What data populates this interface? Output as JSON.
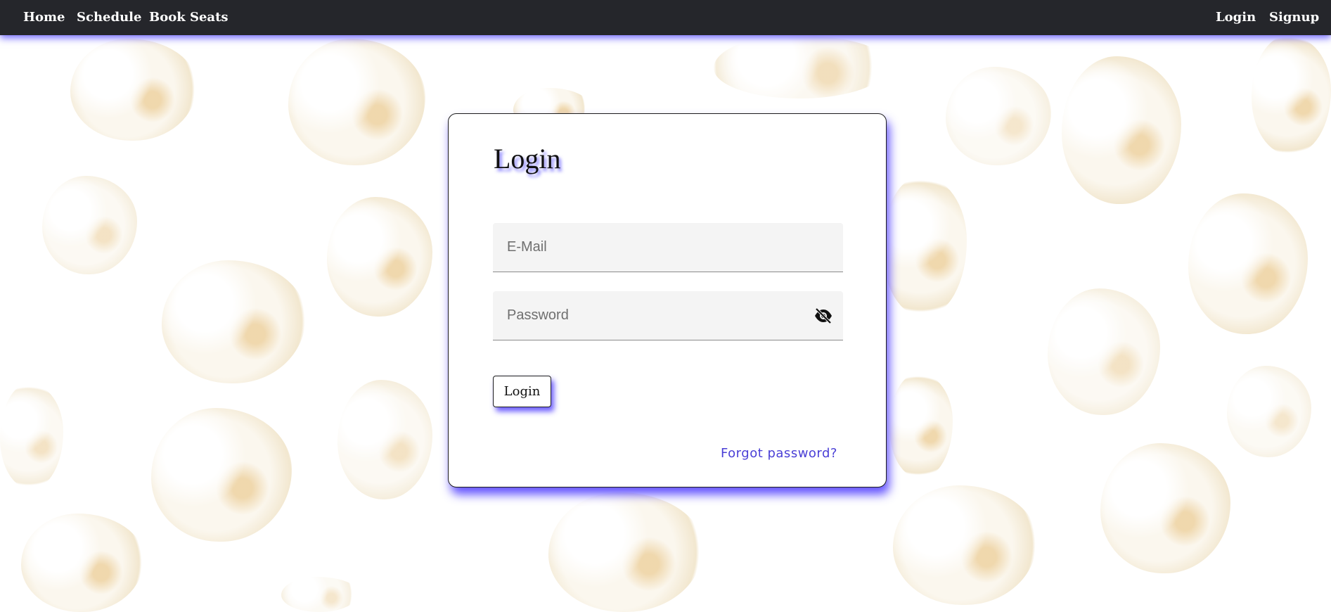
{
  "nav": {
    "home_label": "Home",
    "schedule_label": "Schedule",
    "book_seats_label": "Book Seats",
    "login_label": "Login",
    "signup_label": "Signup"
  },
  "login_form": {
    "title": "Login",
    "email_placeholder": "E-Mail",
    "email_value": "",
    "password_placeholder": "Password",
    "password_value": "",
    "password_toggle_icon": "eye-off-icon",
    "submit_label": "Login",
    "forgot_password_label": "Forgot password?"
  },
  "colors": {
    "navbar_bg": "#25262b",
    "accent_glow": "#5a50ff",
    "link": "#4a3fd6"
  },
  "background_image": "popcorn"
}
